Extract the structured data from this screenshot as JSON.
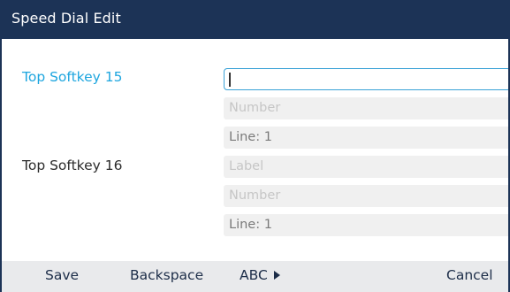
{
  "window": {
    "title": "Speed Dial Edit"
  },
  "entries": [
    {
      "label": "Top Softkey 15",
      "fields": {
        "label_value": "",
        "number_placeholder": "Number",
        "line": "Line: 1"
      }
    },
    {
      "label": "Top Softkey 16",
      "fields": {
        "label_placeholder": "Label",
        "number_placeholder": "Number",
        "line": "Line: 1"
      }
    }
  ],
  "softkeys": {
    "save": "Save",
    "backspace": "Backspace",
    "abc": "ABC",
    "cancel": "Cancel"
  },
  "colors": {
    "titlebar": "#1c3356",
    "active_label": "#1ea6df",
    "focus_border": "#3aa2d7",
    "softkey_bar": "#e9eaec"
  },
  "icons": {
    "abc_arrow": "triangle-right-icon"
  }
}
